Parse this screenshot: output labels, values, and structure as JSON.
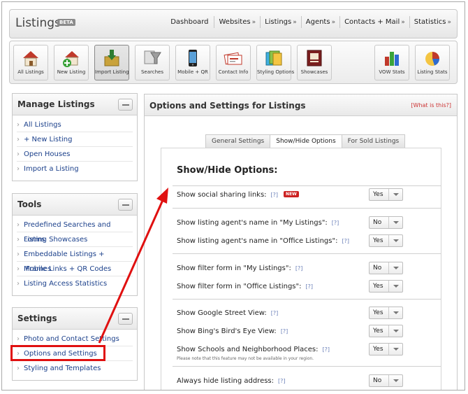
{
  "app": {
    "title": "Listings",
    "badge": "BETA"
  },
  "topnav": [
    {
      "label": "Dashboard",
      "caret": ""
    },
    {
      "label": "Websites",
      "caret": "»"
    },
    {
      "label": "Listings",
      "caret": "»"
    },
    {
      "label": "Agents",
      "caret": "»"
    },
    {
      "label": "Contacts + Mail",
      "caret": "»"
    },
    {
      "label": "Statistics",
      "caret": "»"
    }
  ],
  "toolbar": {
    "all_listings": "All Listings",
    "new_listing": "New Listing",
    "import_listing": "Import Listing",
    "searches": "Searches",
    "mobile_qr": "Mobile + QR",
    "contact_info": "Contact Info",
    "styling_options": "Styling Options",
    "showcases": "Showcases",
    "vow_stats": "VOW Stats",
    "listing_stats": "Listing Stats"
  },
  "manage": {
    "title": "Manage Listings",
    "items": [
      "All Listings",
      "+ New Listing",
      "Open Houses",
      "Import a Listing"
    ]
  },
  "tools": {
    "title": "Tools",
    "items": [
      "Predefined Searches and Forms",
      "Listing Showcases",
      "Embeddable Listings + IFrames",
      "Mobile Links + QR Codes",
      "Listing Access Statistics"
    ]
  },
  "settings": {
    "title": "Settings",
    "items": [
      "Photo and Contact Settings",
      "Options and Settings",
      "Styling and Templates"
    ]
  },
  "main": {
    "title": "Options and Settings for Listings",
    "what_link": "[What is this?]",
    "tabs": [
      "General Settings",
      "Show/Hide Options",
      "For Sold Listings"
    ],
    "section_title": "Show/Hide Options:",
    "help": "[?]",
    "new_badge": "NEW",
    "options": [
      {
        "label": "Show social sharing links:",
        "value": "Yes"
      },
      {
        "label": "Show listing agent's name in \"My Listings\":",
        "value": "No"
      },
      {
        "label": "Show listing agent's name in \"Office Listings\":",
        "value": "Yes"
      },
      {
        "label": "Show filter form in \"My Listings\":",
        "value": "No"
      },
      {
        "label": "Show filter form in \"Office Listings\":",
        "value": "Yes"
      },
      {
        "label": "Show Google Street View:",
        "value": "Yes"
      },
      {
        "label": "Show Bing's Bird's Eye View:",
        "value": "Yes"
      },
      {
        "label": "Show Schools and Neighborhood Places:",
        "value": "Yes",
        "note": "Please note that this feature may not be available in your region."
      },
      {
        "label": "Always hide listing address:",
        "value": "No"
      }
    ]
  },
  "colors": {
    "link": "#1a3f8a",
    "annotation": "#e01010",
    "accent_red": "#c22"
  }
}
